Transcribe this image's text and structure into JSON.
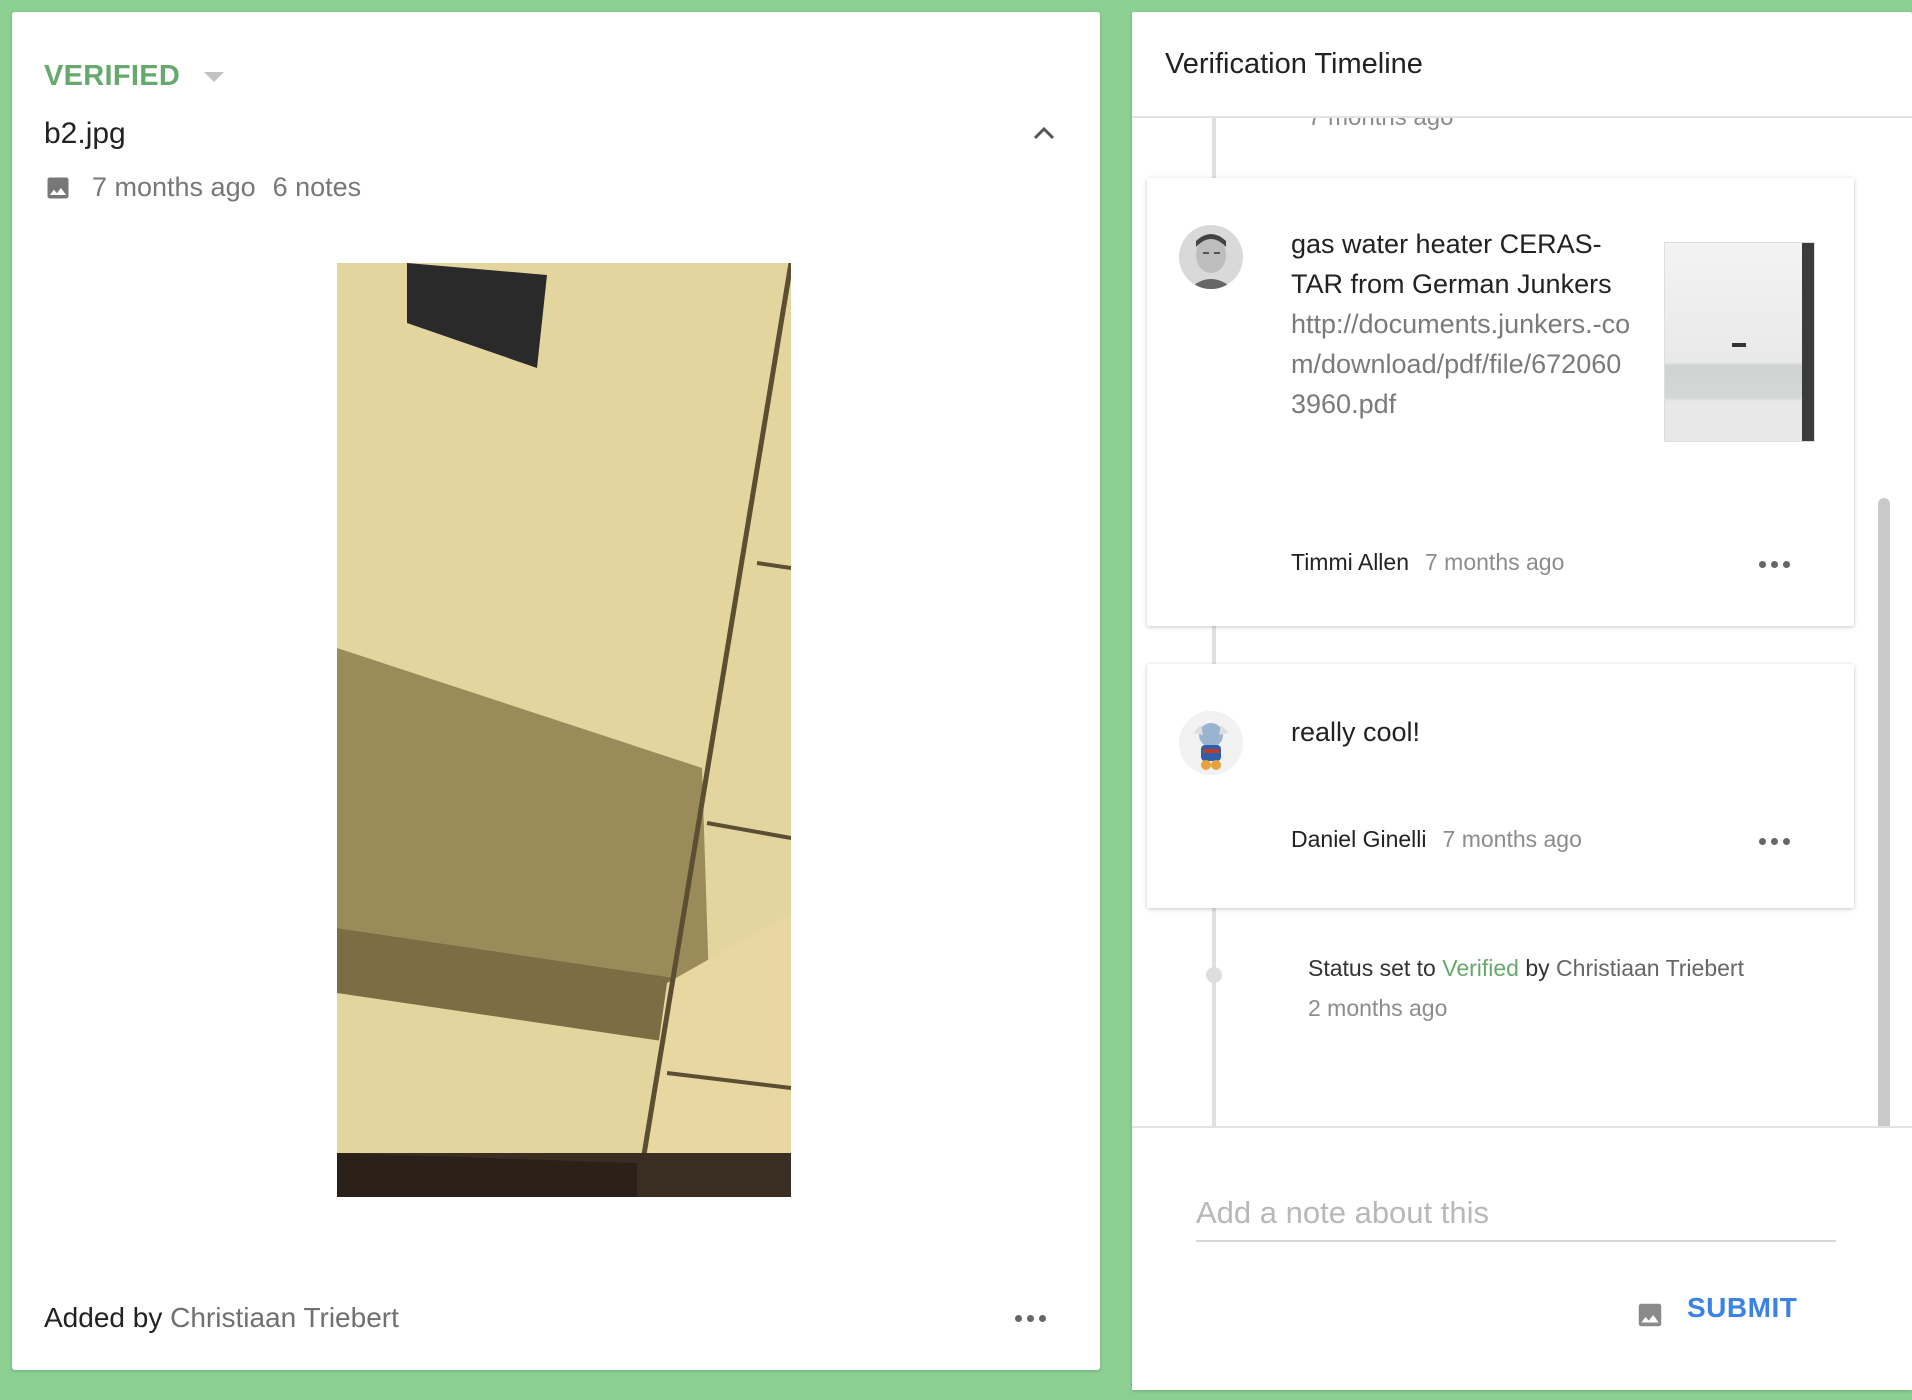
{
  "media": {
    "status": "VERIFIED",
    "title": "b2.jpg",
    "time": "7 months ago",
    "notes": "6 notes",
    "added_by_prefix": "Added by",
    "added_by_name": "Christiaan Triebert"
  },
  "timeline": {
    "title": "Verification Timeline",
    "clipped_time": "7 months ago",
    "notes": [
      {
        "text": "gas water heater CERAS-TAR from German Junkers",
        "link": "http://documents.junkers.-com/download/pdf/file/6720603960.pdf",
        "author": "Timmi Allen",
        "time": "7 months ago"
      },
      {
        "text": "really cool!",
        "author": "Daniel Ginelli",
        "time": "7 months ago"
      }
    ],
    "status_event": {
      "prefix": "Status set to",
      "status": "Verified",
      "by": "by",
      "user": "Christiaan Triebert",
      "time": "2 months ago"
    }
  },
  "composer": {
    "placeholder": "Add a note about this",
    "submit_label": "SUBMIT"
  },
  "colors": {
    "background": "#8bcf92",
    "verified_green": "#67a86d",
    "submit_blue": "#3b82e6"
  },
  "icons": [
    "chevron-down-icon",
    "chevron-up-icon",
    "image-icon",
    "more-icon",
    "attach-image-icon"
  ]
}
